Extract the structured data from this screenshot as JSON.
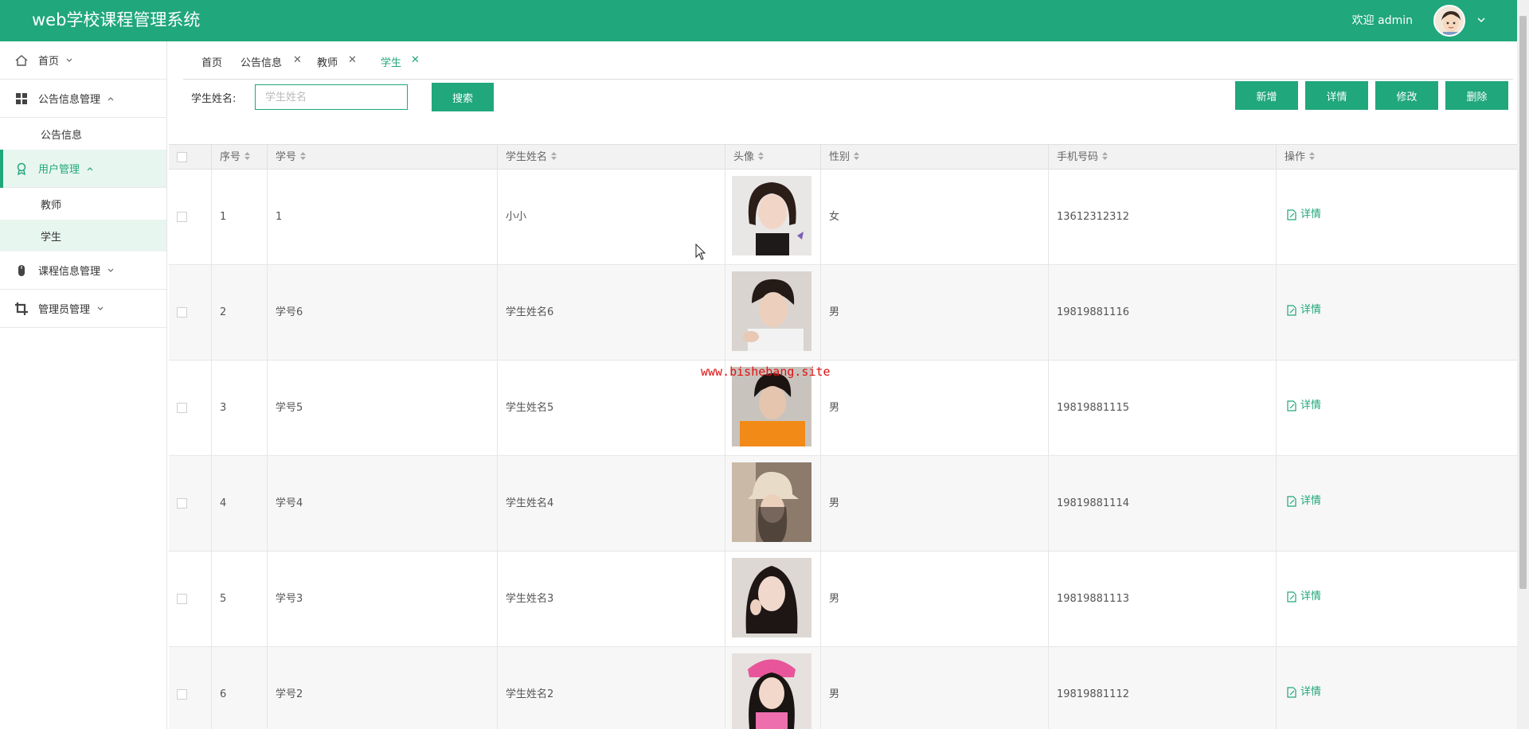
{
  "header": {
    "app_title": "web学校课程管理系统",
    "welcome": "欢迎 admin",
    "brand_color": "#20a77b"
  },
  "sidebar": {
    "items": [
      {
        "label": "首页",
        "icon": "home-icon",
        "chevron": "down"
      },
      {
        "label": "公告信息管理",
        "icon": "grid-icon",
        "chevron": "up"
      },
      {
        "label": "公告信息",
        "sub": true
      },
      {
        "label": "用户管理",
        "icon": "user-badge-icon",
        "chevron": "up",
        "active": true
      },
      {
        "label": "教师",
        "sub": true
      },
      {
        "label": "学生",
        "sub": true,
        "active": true
      },
      {
        "label": "课程信息管理",
        "icon": "mouse-icon",
        "chevron": "down"
      },
      {
        "label": "管理员管理",
        "icon": "crop-icon",
        "chevron": "down"
      }
    ]
  },
  "tabs": [
    {
      "label": "首页",
      "closable": false
    },
    {
      "label": "公告信息",
      "closable": true
    },
    {
      "label": "教师",
      "closable": true
    },
    {
      "label": "学生",
      "closable": true,
      "active": true
    }
  ],
  "search": {
    "label": "学生姓名:",
    "placeholder": "学生姓名",
    "value": "",
    "button": "搜索"
  },
  "actions": {
    "add": "新增",
    "detail": "详情",
    "edit": "修改",
    "delete": "删除"
  },
  "table": {
    "columns": [
      "序号",
      "学号",
      "学生姓名",
      "头像",
      "性别",
      "手机号码",
      "操作"
    ],
    "rows": [
      {
        "index": "1",
        "student_id": "1",
        "name": "小小",
        "gender": "女",
        "phone": "13612312312",
        "action": "详情"
      },
      {
        "index": "2",
        "student_id": "学号6",
        "name": "学生姓名6",
        "gender": "男",
        "phone": "19819881116",
        "action": "详情"
      },
      {
        "index": "3",
        "student_id": "学号5",
        "name": "学生姓名5",
        "gender": "男",
        "phone": "19819881115",
        "action": "详情"
      },
      {
        "index": "4",
        "student_id": "学号4",
        "name": "学生姓名4",
        "gender": "男",
        "phone": "19819881114",
        "action": "详情"
      },
      {
        "index": "5",
        "student_id": "学号3",
        "name": "学生姓名3",
        "gender": "男",
        "phone": "19819881113",
        "action": "详情"
      },
      {
        "index": "6",
        "student_id": "学号2",
        "name": "学生姓名2",
        "gender": "男",
        "phone": "19819881112",
        "action": "详情"
      }
    ]
  },
  "watermark": "www.bishebang.site"
}
